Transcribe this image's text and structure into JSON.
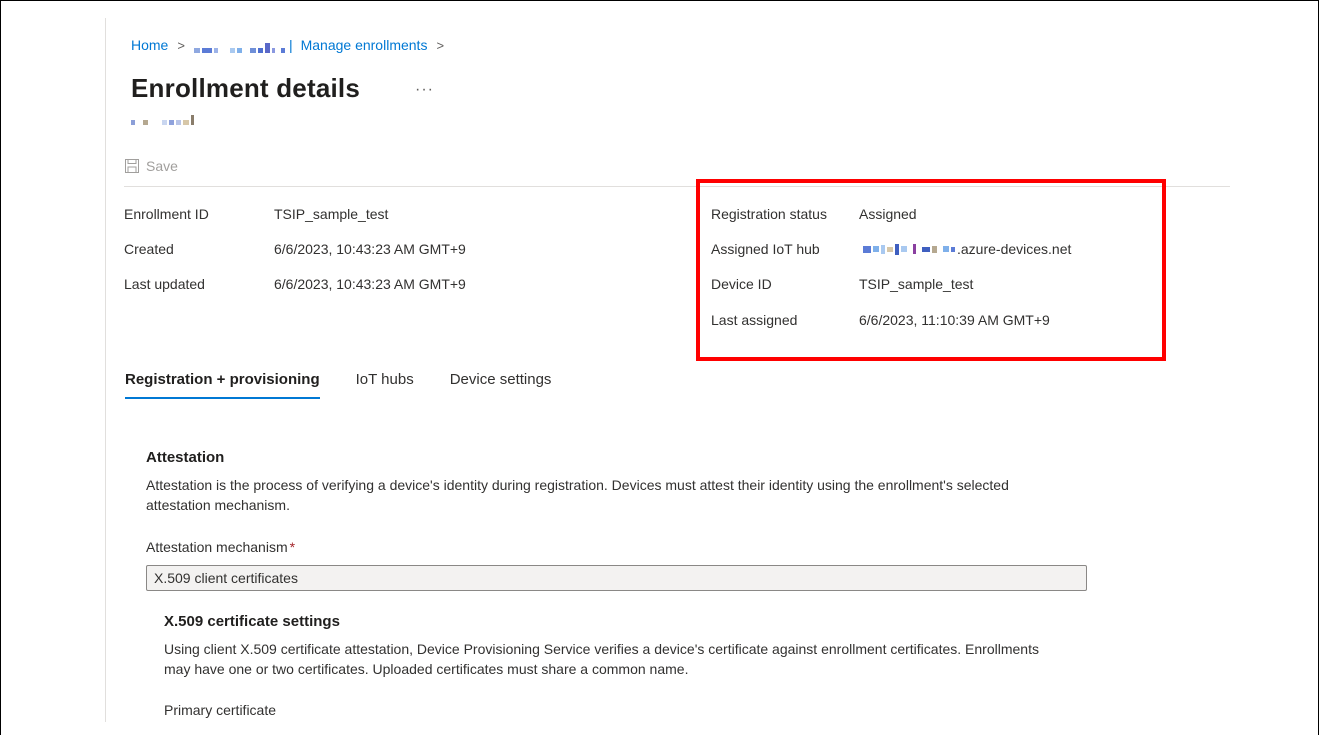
{
  "breadcrumb": {
    "home": "Home",
    "separator": ">",
    "blurred_segment": "Manage enrollments"
  },
  "page": {
    "title": "Enrollment details",
    "more": "···"
  },
  "toolbar": {
    "save_label": "Save",
    "save_icon": "save-icon"
  },
  "props_left": [
    {
      "label": "Enrollment ID",
      "value": "TSIP_sample_test"
    },
    {
      "label": "Created",
      "value": "6/6/2023, 10:43:23 AM GMT+9"
    },
    {
      "label": "Last updated",
      "value": "6/6/2023, 10:43:23 AM GMT+9"
    }
  ],
  "props_right": [
    {
      "label": "Registration status",
      "value": "Assigned"
    },
    {
      "label": "Assigned IoT hub",
      "value": ".azure-devices.net"
    },
    {
      "label": "Device ID",
      "value": "TSIP_sample_test"
    },
    {
      "label": "Last assigned",
      "value": "6/6/2023, 11:10:39 AM GMT+9"
    }
  ],
  "highlight_color": "#ff0000",
  "tabs": [
    {
      "label": "Registration + provisioning",
      "active": true
    },
    {
      "label": "IoT hubs",
      "active": false
    },
    {
      "label": "Device settings",
      "active": false
    }
  ],
  "attestation": {
    "title": "Attestation",
    "description": "Attestation is the process of verifying a device's identity during registration. Devices must attest their identity using the enrollment's selected attestation mechanism.",
    "mechanism_label": "Attestation mechanism",
    "required_marker": "*",
    "mechanism_value": "X.509 client certificates"
  },
  "x509": {
    "title": "X.509 certificate settings",
    "description": "Using client X.509 certificate attestation, Device Provisioning Service verifies a device's certificate against enrollment certificates. Enrollments may have one or two certificates. Uploaded certificates must share a common name.",
    "primary_certificate_label": "Primary certificate"
  },
  "colors": {
    "accent": "#0078d4",
    "text": "#323130",
    "disabled": "#a19f9d"
  }
}
